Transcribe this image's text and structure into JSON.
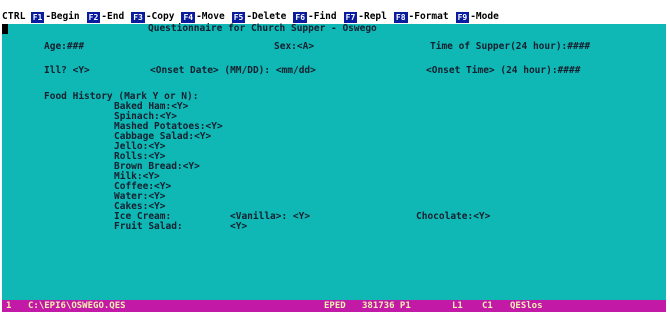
{
  "fkey_bar": {
    "ctrl_label": "CTRL",
    "keys": [
      {
        "num": "F1",
        "label": "-Begin"
      },
      {
        "num": "F2",
        "label": "-End"
      },
      {
        "num": "F3",
        "label": "-Copy"
      },
      {
        "num": "F4",
        "label": "-Move"
      },
      {
        "num": "F5",
        "label": "-Delete"
      },
      {
        "num": "F6",
        "label": "-Find"
      },
      {
        "num": "F7",
        "label": "-Repl"
      },
      {
        "num": "F8",
        "label": "-Format"
      },
      {
        "num": "F9",
        "label": "-Mode"
      }
    ]
  },
  "editor": {
    "title": "Questionnaire for Church Supper - Oswego",
    "age_line": "Age:###",
    "sex_line": "Sex:<A>",
    "time_line": "Time of Supper(24 hour):####",
    "ill_line": "Ill? <Y>",
    "onset_date_line": "<Onset Date> (MM/DD): <mm/dd>",
    "onset_time_line": "<Onset Time> (24 hour):####",
    "food_history_heading": "Food History (Mark Y or N):",
    "foods": [
      "Baked Ham:<Y>",
      "Spinach:<Y>",
      "Mashed Potatoes:<Y>",
      "Cabbage Salad:<Y>",
      "Jello:<Y>",
      "Rolls:<Y>",
      "Brown Bread:<Y>",
      "Milk:<Y>",
      "Coffee:<Y>",
      "Water:<Y>",
      "Cakes:<Y>"
    ],
    "ice_cream_label": "Ice Cream:",
    "vanilla_field": "<Vanilla>: <Y>",
    "chocolate_field": "Chocolate:<Y>",
    "fruit_salad_label": "Fruit Salad:",
    "fruit_salad_value": "<Y>"
  },
  "status_bar": {
    "line_no": "1",
    "file_path": "C:\\EPI6\\OSWEGO.QES",
    "mode": "EPED",
    "memory": "381736 P1",
    "line": "L1",
    "column": "C1",
    "file_type": "QESlos"
  },
  "colors": {
    "editor_bg": "#0fb8b4",
    "fkey_badge": "#0a1c9e",
    "status_bg": "#c21aa6"
  }
}
